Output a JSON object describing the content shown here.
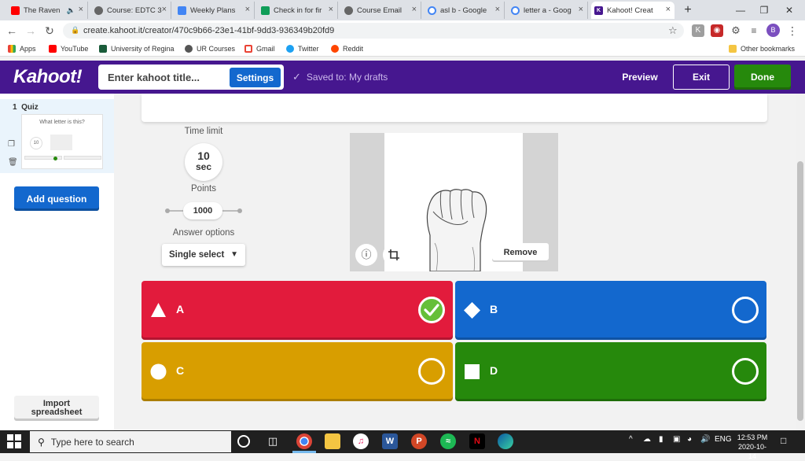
{
  "browser": {
    "tabs": [
      {
        "label": "The Raven",
        "fav_color": "#ff0000"
      },
      {
        "label": "Course: EDTC 3",
        "fav_color": "#555555"
      },
      {
        "label": "Weekly Plans",
        "fav_color": "#4285f4"
      },
      {
        "label": "Check in for fir",
        "fav_color": "#0f9d58"
      },
      {
        "label": "Course Email",
        "fav_color": "#555555"
      },
      {
        "label": "asl b - Google",
        "fav_color": "#4285f4"
      },
      {
        "label": "letter a - Goog",
        "fav_color": "#4285f4"
      },
      {
        "label": "Kahoot! Creat",
        "fav_color": "#46178f"
      }
    ],
    "url": "create.kahoot.it/creator/470c9b66-23e1-41bf-9dd3-936349b20fd9",
    "profile_initial": "B",
    "bookmarks": [
      {
        "label": "Apps",
        "color": "#ea4335"
      },
      {
        "label": "YouTube",
        "color": "#ff0000"
      },
      {
        "label": "University of Regina",
        "color": "#1a5c3a"
      },
      {
        "label": "UR Courses",
        "color": "#555555"
      },
      {
        "label": "Gmail",
        "color": "#ea4335"
      },
      {
        "label": "Twitter",
        "color": "#1da1f2"
      },
      {
        "label": "Reddit",
        "color": "#ff4500"
      }
    ],
    "other_bookmarks": "Other bookmarks"
  },
  "kahoot": {
    "logo": "Kahoot!",
    "title_placeholder": "Enter kahoot title...",
    "settings_label": "Settings",
    "saved_text": "Saved to: My drafts",
    "preview_label": "Preview",
    "exit_label": "Exit",
    "done_label": "Done",
    "brand_color": "#46178f"
  },
  "sidebar": {
    "slide_number": "1",
    "slide_type": "Quiz",
    "thumb_question": "What letter is this?",
    "thumb_time": "10",
    "add_question_label": "Add question",
    "import_label_1": "Import",
    "import_label_2": "spreadsheet"
  },
  "settings": {
    "time_limit_label": "Time limit",
    "time_value": "10",
    "time_unit": "sec",
    "points_label": "Points",
    "points_value": "1000",
    "answer_options_label": "Answer options",
    "answer_options_value": "Single select"
  },
  "media": {
    "remove_label": "Remove"
  },
  "answers": [
    {
      "label": "A",
      "color": "#e21b3c",
      "shape": "triangle",
      "correct": true
    },
    {
      "label": "B",
      "color": "#1368ce",
      "shape": "diamond",
      "correct": false
    },
    {
      "label": "C",
      "color": "#d89e00",
      "shape": "circle",
      "correct": false
    },
    {
      "label": "D",
      "color": "#26890c",
      "shape": "square",
      "correct": false
    }
  ],
  "taskbar": {
    "search_placeholder": "Type here to search",
    "language": "ENG",
    "time": "12:53 PM",
    "date": "2020-10-14"
  }
}
